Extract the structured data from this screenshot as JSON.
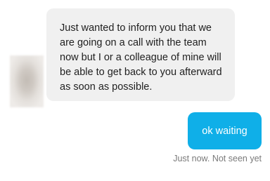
{
  "conversation": {
    "incoming": {
      "avatar_icon": "blurred-user-avatar",
      "message": "Just wanted to inform you that we are going on a call with the team now but I or a colleague of mine will be able to get back to you afterward as soon as possible."
    },
    "outgoing": {
      "message": "ok waiting",
      "status": "Just now. Not seen yet"
    }
  },
  "colors": {
    "incoming_bubble": "#f0f0f0",
    "outgoing_bubble": "#0fafe8",
    "status_text": "#7a7a7a"
  }
}
